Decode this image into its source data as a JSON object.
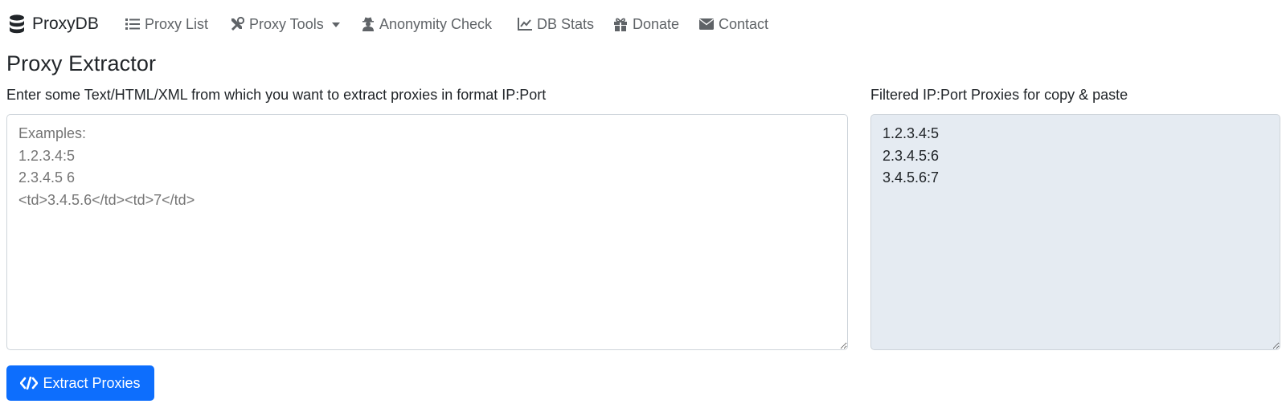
{
  "navbar": {
    "brand": {
      "label": "ProxyDB",
      "icon": "database-icon"
    },
    "items": [
      {
        "label": "Proxy List",
        "icon": "list-icon"
      },
      {
        "label": "Proxy Tools",
        "icon": "tools-icon",
        "dropdown": true
      },
      {
        "label": "Anonymity Check",
        "icon": "user-secret-icon"
      },
      {
        "label": "DB Stats",
        "icon": "chart-line-icon"
      },
      {
        "label": "Donate",
        "icon": "gift-icon"
      },
      {
        "label": "Contact",
        "icon": "envelope-icon"
      }
    ]
  },
  "page": {
    "title": "Proxy Extractor",
    "input_label": "Enter some Text/HTML/XML from which you want to extract proxies in format IP:Port",
    "input_placeholder": "Examples:\n1.2.3.4:5\n2.3.4.5 6\n<td>3.4.5.6</td><td>7</td>",
    "output_label": "Filtered IP:Port Proxies for copy & paste",
    "output_value": "1.2.3.4:5\n2.3.4.5:6\n3.4.5.6:7",
    "extract_button": "Extract Proxies"
  },
  "colors": {
    "primary": "#0d6efd",
    "output_background": "#e5ebf2",
    "nav_text": "#5f6367"
  }
}
